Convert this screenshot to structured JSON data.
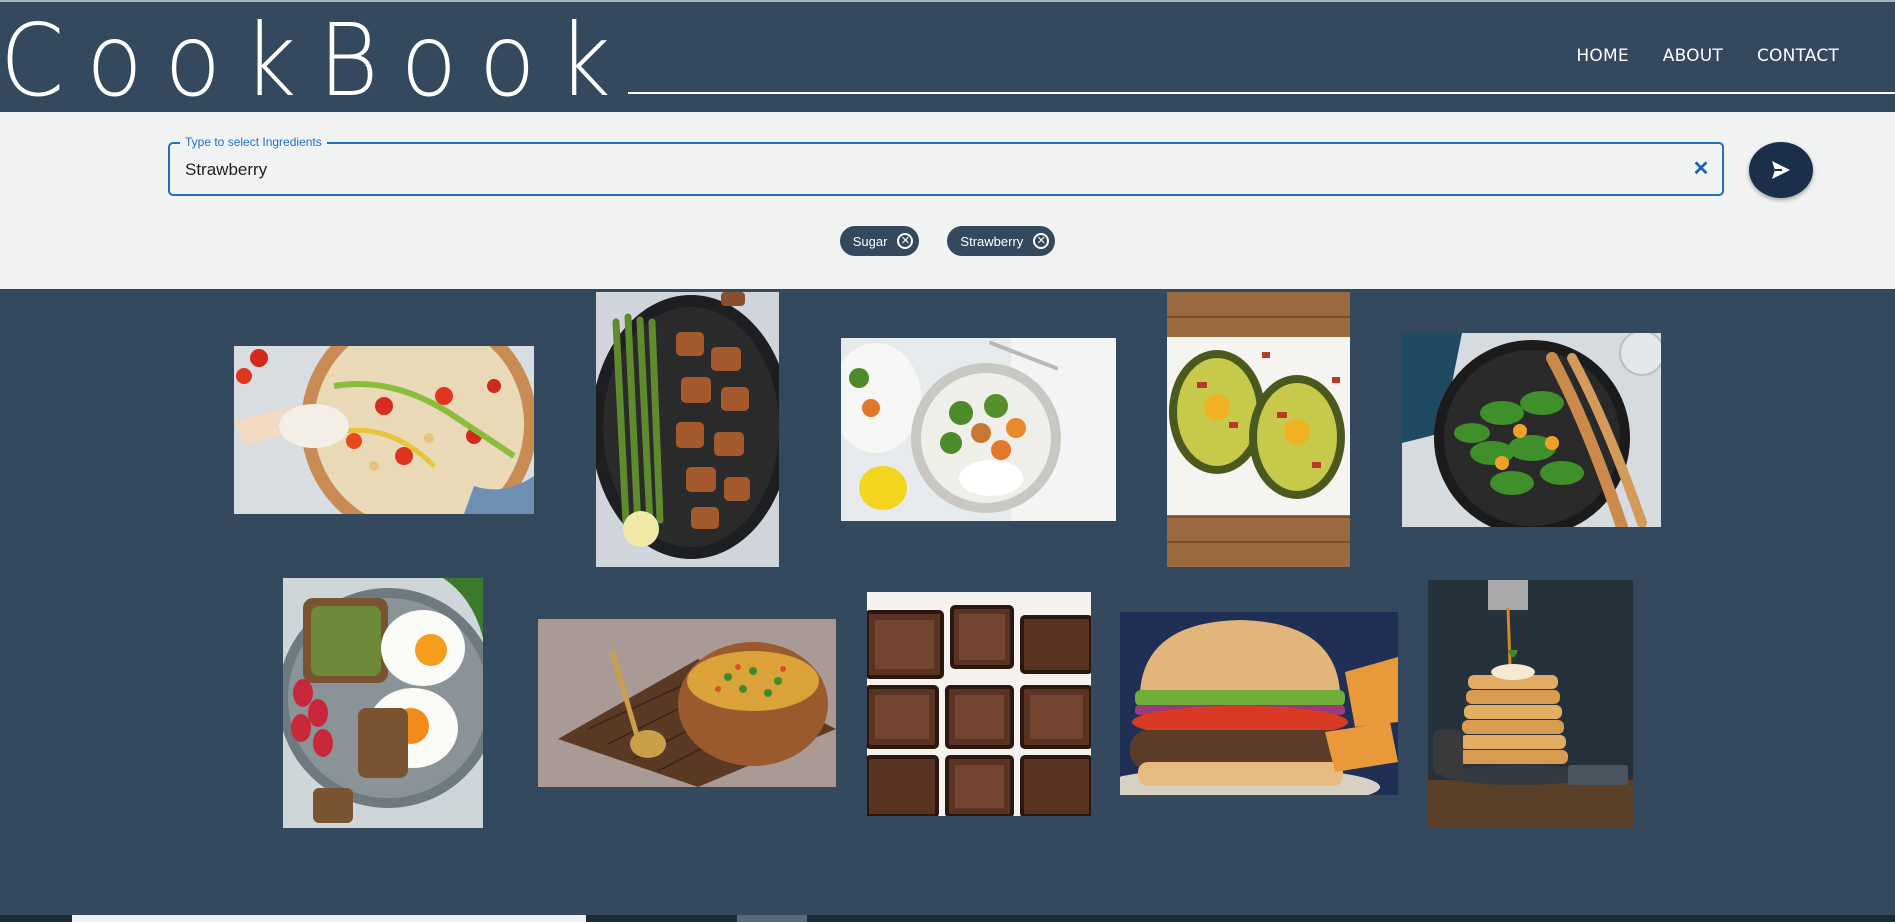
{
  "header": {
    "logo": "CookBook",
    "nav": [
      {
        "label": "HOME"
      },
      {
        "label": "ABOUT"
      },
      {
        "label": "CONTACT"
      }
    ]
  },
  "search": {
    "label": "Type to select Ingredients",
    "value": "Strawberry",
    "clear_icon": "close-icon",
    "submit_icon": "send-icon"
  },
  "chips": [
    {
      "label": "Sugar"
    },
    {
      "label": "Strawberry"
    }
  ],
  "colors": {
    "header_bg": "#34495e",
    "search_bg": "#f1f3f2",
    "accent": "#1f6fc5",
    "send_button": "#1b2f4a"
  },
  "recipes": [
    {
      "dish": "chickpea-salad"
    },
    {
      "dish": "chicken-asparagus-skillet"
    },
    {
      "dish": "chicken-broccoli-rice-bowl"
    },
    {
      "dish": "baked-avocado-eggs"
    },
    {
      "dish": "spinach-orange-salad"
    },
    {
      "dish": "eggs-toast-radishes"
    },
    {
      "dish": "vegetable-porridge"
    },
    {
      "dish": "brownies"
    },
    {
      "dish": "burger-with-chips"
    },
    {
      "dish": "pancake-stack"
    }
  ]
}
